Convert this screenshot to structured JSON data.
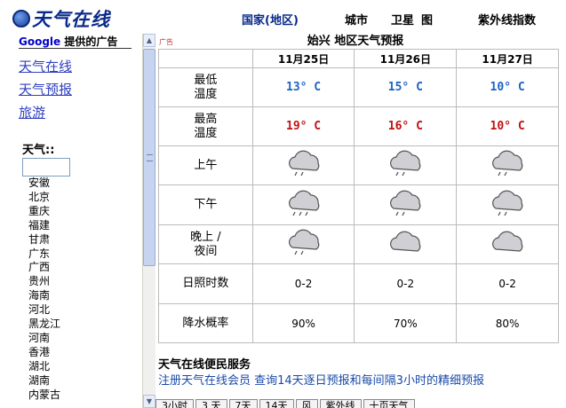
{
  "header": {
    "logo_text": "天气在线",
    "nav": [
      "国家(地区)",
      "城市",
      "卫星",
      "图",
      "紫外线指数"
    ]
  },
  "sidebar": {
    "ad_title_brand": "Google",
    "ad_title_rest": " 提供的广告",
    "ad_links": [
      "天气在线",
      "天气预报",
      "旅游"
    ],
    "weather_label": "天气::",
    "weather_input_value": "",
    "provinces": [
      "安徽",
      "北京",
      "重庆",
      "福建",
      "甘肃",
      "广东",
      "广西",
      "贵州",
      "海南",
      "河北",
      "黑龙江",
      "河南",
      "香港",
      "湖北",
      "湖南",
      "内蒙古"
    ]
  },
  "content": {
    "ad_tag": "广告",
    "forecast_title": "始兴  地区天气预报",
    "columns": [
      "11月25日",
      "11月26日",
      "11月27日"
    ],
    "rows": {
      "low_label": "最低\n温度",
      "low": [
        "13° C",
        "15° C",
        "10° C"
      ],
      "high_label": "最高\n温度",
      "high": [
        "19° C",
        "16° C",
        "10° C"
      ],
      "morning_label": "上午",
      "afternoon_label": "下午",
      "night_label": "晚上 /\n夜间",
      "sunshine_label": "日照时数",
      "sunshine": [
        "0-2",
        "0-2",
        "0-2"
      ],
      "rain_label": "降水概率",
      "rain": [
        "90%",
        "70%",
        "80%"
      ]
    },
    "icons": {
      "morning": [
        "light-rain-cloud-icon",
        "light-rain-cloud-icon",
        "light-rain-cloud-icon"
      ],
      "afternoon": [
        "rain-cloud-icon",
        "light-rain-cloud-icon",
        "light-rain-cloud-icon"
      ],
      "night": [
        "light-rain-cloud-icon",
        "cloud-icon",
        "cloud-icon"
      ]
    },
    "service_title": "天气在线便民服务",
    "service_links": "注册天气在线会员 查询14天逐日预报和每间隔3小时的精细预报",
    "bottom_tabs": [
      "3小时",
      "3 天",
      "7天",
      "14天",
      "风",
      "紫外线",
      "十页天气"
    ]
  },
  "colors": {
    "low_temp": "#1d62c4",
    "high_temp": "#c01010",
    "link": "#3040c0",
    "logo": "#0a2a8a"
  }
}
